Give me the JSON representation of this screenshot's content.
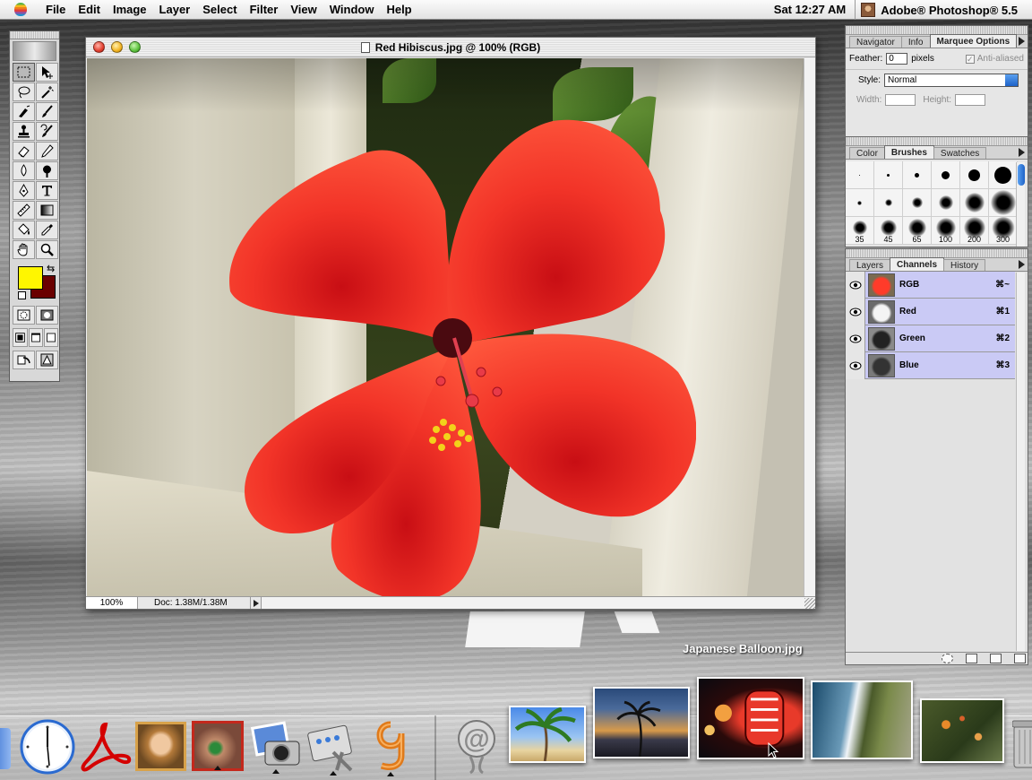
{
  "menubar": {
    "apple": "apple-icon",
    "items": [
      "File",
      "Edit",
      "Image",
      "Layer",
      "Select",
      "Filter",
      "View",
      "Window",
      "Help"
    ],
    "clock": "Sat 12:27 AM",
    "app_name": "Adobe® Photoshop® 5.5"
  },
  "document": {
    "title": "Red Hibiscus.jpg @ 100% (RGB)",
    "zoom": "100%",
    "doc_size": "Doc: 1.38M/1.38M"
  },
  "toolbox": {
    "foreground_color": "#fff600",
    "background_color": "#6a0000",
    "tools": [
      "rectangular-marquee",
      "move",
      "lasso",
      "magic-wand",
      "airbrush",
      "paintbrush",
      "rubber-stamp",
      "history-brush",
      "eraser",
      "pencil",
      "blur",
      "burn",
      "pen",
      "type",
      "measure",
      "gradient",
      "paint-bucket",
      "eyedropper",
      "hand",
      "zoom"
    ]
  },
  "options_palette": {
    "tabs": [
      "Navigator",
      "Info",
      "Marquee Options"
    ],
    "active_tab": "Marquee Options",
    "feather_label": "Feather:",
    "feather_value": "0",
    "feather_unit": "pixels",
    "anti_aliased_label": "Anti-aliased",
    "style_label": "Style:",
    "style_value": "Normal",
    "width_label": "Width:",
    "height_label": "Height:"
  },
  "brushes_palette": {
    "tabs": [
      "Color",
      "Brushes",
      "Swatches"
    ],
    "active_tab": "Brushes",
    "size_labels": [
      "35",
      "45",
      "65",
      "100",
      "200",
      "300"
    ]
  },
  "channels_palette": {
    "tabs": [
      "Layers",
      "Channels",
      "History"
    ],
    "active_tab": "Channels",
    "channels": [
      {
        "name": "RGB",
        "shortcut": "⌘~"
      },
      {
        "name": "Red",
        "shortcut": "⌘1"
      },
      {
        "name": "Green",
        "shortcut": "⌘2"
      },
      {
        "name": "Blue",
        "shortcut": "⌘3"
      }
    ]
  },
  "desktop": {
    "label": "Japanese Balloon.jpg"
  },
  "dock": {
    "items": [
      "finder",
      "clock",
      "acrobat",
      "venus-portrait",
      "eye-image-app",
      "iphoto-camera",
      "system-preferences",
      "os9-classic",
      "mail-at",
      "palm-tree-photo",
      "sunset-photo",
      "japanese-balloon-photo",
      "coastline-photo",
      "koi-photo",
      "trash"
    ]
  }
}
